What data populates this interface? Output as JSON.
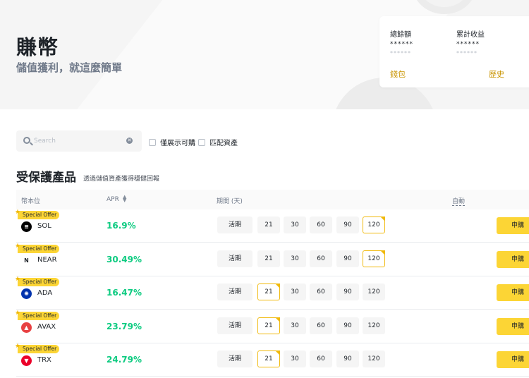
{
  "hero": {
    "title": "賺幣",
    "subtitle": "儲值獲利，就這麼簡單"
  },
  "balance_card": {
    "total_label": "總餘額",
    "total_value": "******",
    "total_sub": "******",
    "earned_label": "累計收益",
    "earned_value": "******",
    "earned_sub": "******",
    "wallet_link": "錢包",
    "history_link": "歷史"
  },
  "filters": {
    "search_placeholder": "Search",
    "clear_icon": "close-icon",
    "show_available_label": "僅展示可購",
    "match_assets_label": "匹配資產"
  },
  "section": {
    "title": "受保護產品",
    "subtitle": "透過儲值資產獲得穩健回報"
  },
  "table_header": {
    "coin": "幣本位",
    "apr": "APR",
    "sort_icon": "sort-icon",
    "period": "期間 (天)",
    "auto": "自動"
  },
  "rows": [
    {
      "badge": "Special Offer",
      "coin": "SOL",
      "apr": "16.9%",
      "icon_color": "#000000",
      "selected": "120"
    },
    {
      "badge": "Special Offer",
      "coin": "NEAR",
      "apr": "30.49%",
      "icon_color": "#ffffff",
      "selected": "120"
    },
    {
      "badge": "Special Offer",
      "coin": "ADA",
      "apr": "16.47%",
      "icon_color": "#0033ad",
      "selected": "21"
    },
    {
      "badge": "Special Offer",
      "coin": "AVAX",
      "apr": "23.79%",
      "icon_color": "#e84142",
      "selected": "21"
    },
    {
      "badge": "Special Offer",
      "coin": "TRX",
      "apr": "24.79%",
      "icon_color": "#eb0029",
      "selected": "21"
    }
  ],
  "period_options": [
    "活期",
    "21",
    "30",
    "60",
    "90",
    "120"
  ],
  "apply_label": "申購",
  "colors": {
    "accent_yellow": "#fcd535",
    "apr_green": "#0ecb81",
    "link_gold": "#c99400"
  }
}
